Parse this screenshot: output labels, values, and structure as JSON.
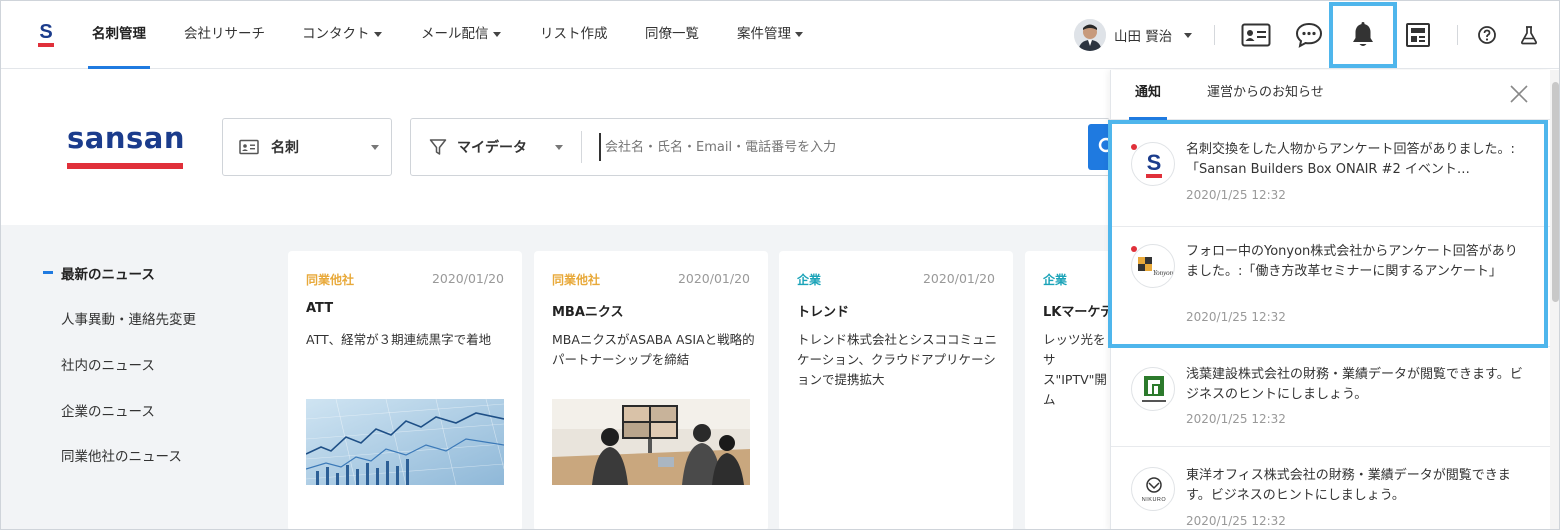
{
  "nav": {
    "logo_letter": "S",
    "items": [
      {
        "label": "名刺管理",
        "active": true,
        "dropdown": false
      },
      {
        "label": "会社リサーチ",
        "active": false,
        "dropdown": false
      },
      {
        "label": "コンタクト",
        "active": false,
        "dropdown": true
      },
      {
        "label": "メール配信",
        "active": false,
        "dropdown": true
      },
      {
        "label": "リスト作成",
        "active": false,
        "dropdown": false
      },
      {
        "label": "同僚一覧",
        "active": false,
        "dropdown": false
      },
      {
        "label": "案件管理",
        "active": false,
        "dropdown": true
      }
    ],
    "user_name": "山田 賢治",
    "icons": [
      "contact-card-icon",
      "chat-bubble-icon",
      "bell-icon",
      "news-icon",
      "help-icon",
      "flask-icon"
    ]
  },
  "search": {
    "logo_text": "sansan",
    "type_label": "名刺",
    "scope_label": "マイデータ",
    "placeholder": "会社名・氏名・Email・電話番号を入力"
  },
  "sidebar": {
    "items": [
      {
        "label": "最新のニュース",
        "active": true
      },
      {
        "label": "人事異動・連絡先変更",
        "active": false
      },
      {
        "label": "社内のニュース",
        "active": false
      },
      {
        "label": "企業のニュース",
        "active": false
      },
      {
        "label": "同業他社のニュース",
        "active": false
      }
    ]
  },
  "news": [
    {
      "category": "同業他社",
      "date": "2020/01/20",
      "title": "ATT",
      "body": "ATT、経常が３期連続黒字で着地",
      "image": "stock-chart"
    },
    {
      "category": "同業他社",
      "date": "2020/01/20",
      "title": "MBAニクス",
      "body": "MBAニクスがASABA ASIAと戦略的パートナーシップを締結",
      "image": "meeting"
    },
    {
      "category": "企業",
      "date": "2020/01/20",
      "title": "トレンド",
      "body": "トレンド株式会社とシスココミュニケーション、クラウドアプリケーションで提携拡大",
      "image": ""
    },
    {
      "category": "企業",
      "date": "",
      "title": "LKマーケテ",
      "body": "レッツ光をサ ス\"IPTV\"開 ム",
      "image": ""
    }
  ],
  "notifications": {
    "tabs": [
      {
        "label": "通知",
        "active": true
      },
      {
        "label": "運営からのお知らせ",
        "active": false
      }
    ],
    "items": [
      {
        "text": "名刺交換をした人物からアンケート回答がありました。:「Sansan Builders Box ONAIR #2 イベント…",
        "time": "2020/1/25 12:32",
        "unread": true,
        "icon": "sansan-logo-icon"
      },
      {
        "text": "フォロー中のYonyon株式会社からアンケート回答がありました。:「働き方改革セミナーに関するアンケート」",
        "time": "2020/1/25 12:32",
        "unread": true,
        "icon": "yonyon-logo-icon",
        "logo_text": "Yonyon"
      },
      {
        "text": "浅葉建設株式会社の財務・業績データが閲覧できます。ビジネスのヒントにしましょう。",
        "time": "2020/1/25 12:32",
        "unread": false,
        "icon": "asaba-logo-icon"
      },
      {
        "text": "東洋オフィス株式会社の財務・業績データが閲覧できます。ビジネスのヒントにしましょう。",
        "time": "2020/1/25 12:32",
        "unread": false,
        "icon": "nikuro-logo-icon",
        "logo_text": "NIKURO"
      }
    ]
  },
  "colors": {
    "accent": "#1f7ae0",
    "brand_red": "#e0303a",
    "brand_navy": "#1b3c8c",
    "highlight": "#4fb6ec",
    "cat_competitor": "#e8a93a",
    "cat_company": "#1aa3b8"
  }
}
